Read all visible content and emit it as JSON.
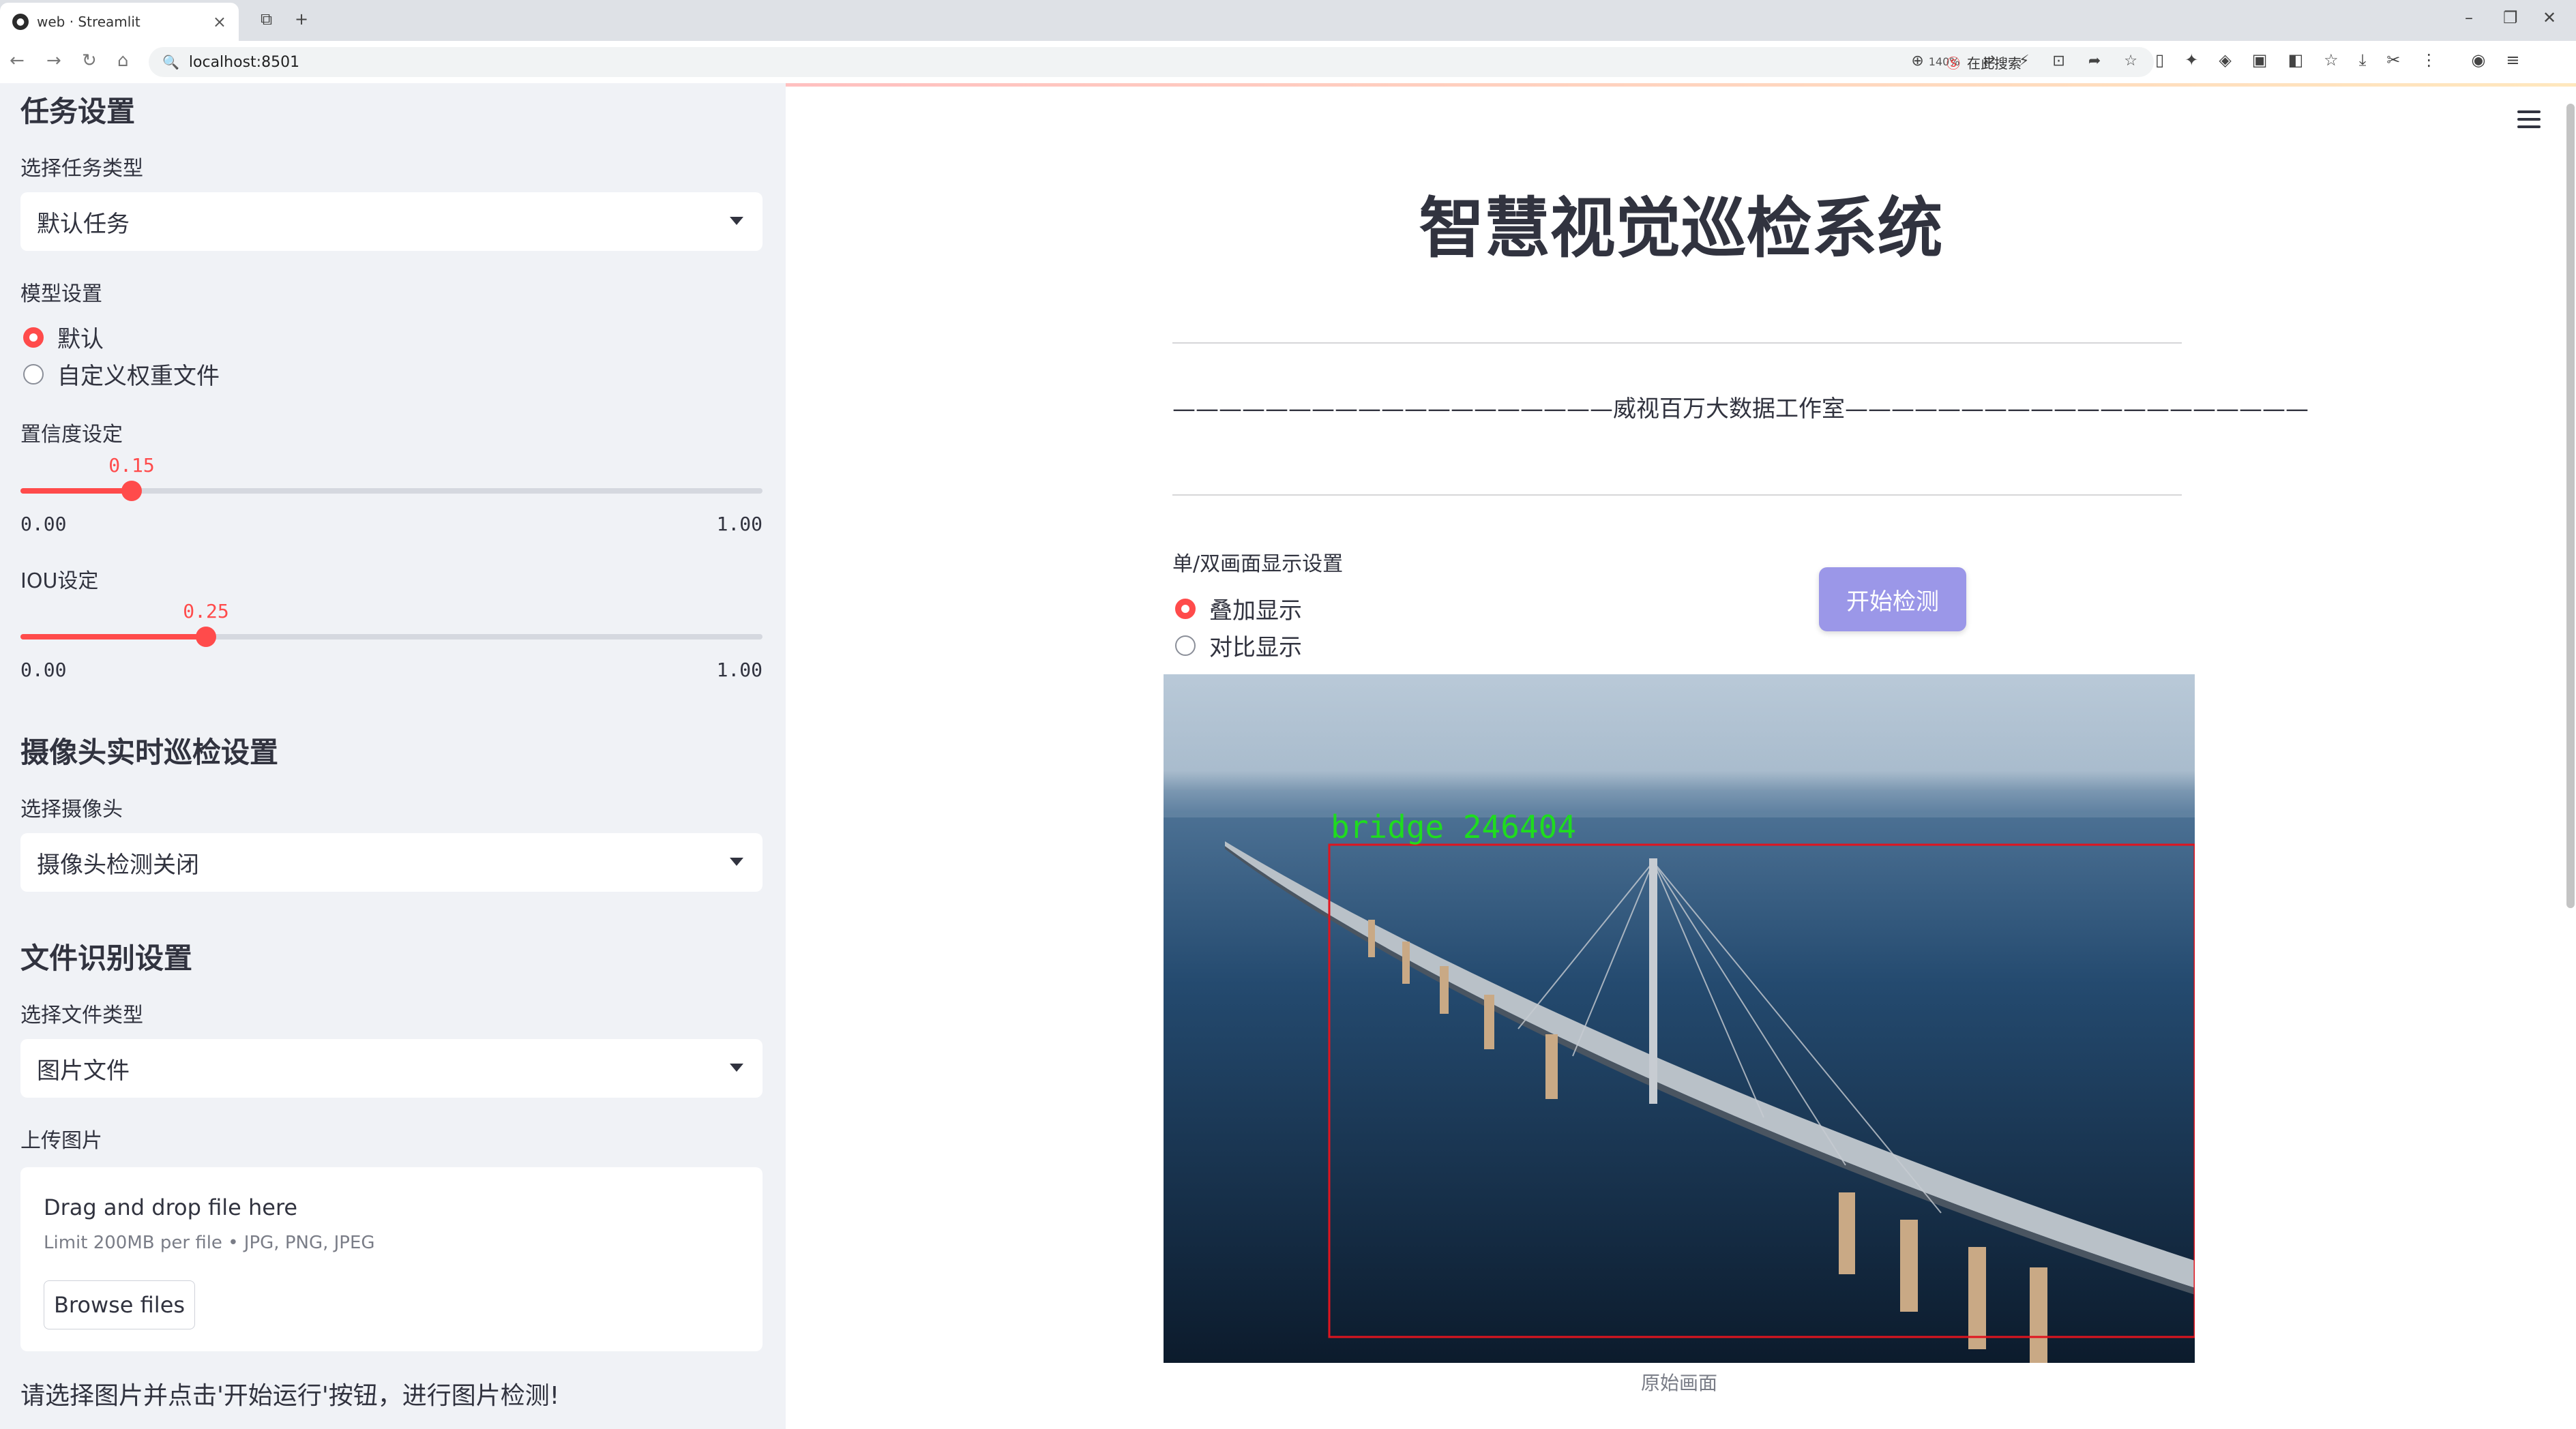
{
  "browser": {
    "tab_title": "web · Streamlit",
    "url": "localhost:8501",
    "zoom": "140%",
    "search_placeholder": "在此搜索"
  },
  "sidebar": {
    "task_section_title": "任务设置",
    "task_type_label": "选择任务类型",
    "task_type_value": "默认任务",
    "model_label": "模型设置",
    "model_options": [
      "默认",
      "自定义权重文件"
    ],
    "model_selected": 0,
    "confidence": {
      "label": "置信度设定",
      "value": "0.15",
      "min": "0.00",
      "max": "1.00",
      "fraction": 0.15
    },
    "iou": {
      "label": "IOU设定",
      "value": "0.25",
      "min": "0.00",
      "max": "1.00",
      "fraction": 0.25
    },
    "camera_section_title": "摄像头实时巡检设置",
    "camera_label": "选择摄像头",
    "camera_value": "摄像头检测关闭",
    "file_section_title": "文件识别设置",
    "file_type_label": "选择文件类型",
    "file_type_value": "图片文件",
    "upload_label": "上传图片",
    "upload_drag_text": "Drag and drop file here",
    "upload_limit_text": "Limit 200MB per file • JPG, PNG, JPEG",
    "browse_button": "Browse files",
    "hint": "请选择图片并点击'开始运行'按钮，进行图片检测!"
  },
  "main": {
    "title": "智慧视觉巡检系统",
    "subtitle": "———————————————————威视百万大数据工作室————————————————————",
    "display_mode_label": "单/双画面显示设置",
    "display_options": [
      "叠加显示",
      "对比显示"
    ],
    "display_selected": 0,
    "start_button": "开始检测",
    "detection_label": "bridge 246404",
    "image_caption": "原始画面"
  },
  "colors": {
    "accent": "#ff4b4b",
    "button": "#9b97e8",
    "sidebar_bg": "#f0f2f6",
    "detection_box": "#e0141e",
    "detection_text": "#1fdc1f"
  }
}
